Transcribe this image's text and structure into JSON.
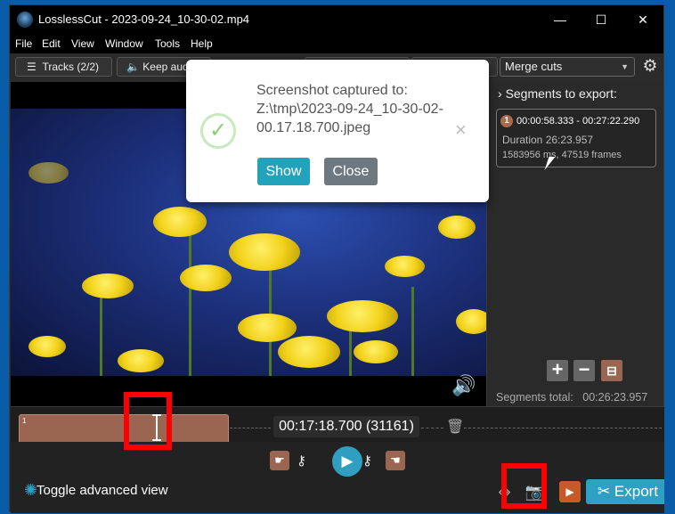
{
  "window": {
    "title": "LosslessCut - 2023-09-24_10-30-02.mp4",
    "controls": {
      "minimize": "—",
      "maximize": "☐",
      "close": "✕"
    }
  },
  "menu": [
    "File",
    "Edit",
    "View",
    "Window",
    "Tools",
    "Help"
  ],
  "toolbar": {
    "tracks_label": "Tracks (2/2)",
    "keep_audio_label": "Keep audio",
    "merge_select": "Merge cuts",
    "settings_icon": "gear-icon"
  },
  "sidebar": {
    "header": "Segments to export:",
    "segment": {
      "number": "1",
      "range": "00:00:58.333 - 00:27:22.290",
      "duration": "Duration 26:23.957",
      "frames": "1583956 ms, 47519 frames"
    },
    "total_label": "Segments total:",
    "total_value": "00:26:23.957"
  },
  "timeline": {
    "segment_number": "1",
    "timecode": "00:17:18.700 (31161)"
  },
  "notification": {
    "message": "Screenshot captured to: Z:\\tmp\\2023-09-24_10-30-02-00.17.18.700.jpeg",
    "show_label": "Show",
    "close_label": "Close"
  },
  "footer": {
    "toggle_advanced": "Toggle advanced view",
    "export_label": "Export"
  },
  "colors": {
    "accent": "#2ea0c3",
    "segment": "#9a6651",
    "highlight": "#ff0000"
  }
}
